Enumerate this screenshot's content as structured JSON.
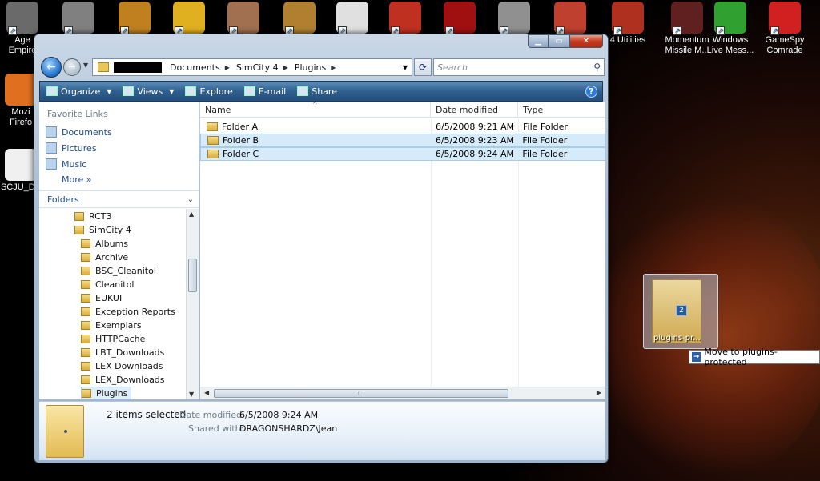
{
  "desktop": {
    "icons_top": [
      {
        "name": "age-empires-icon",
        "label": "Age\nEmpire",
        "color": "#6a6a6a"
      },
      {
        "name": "pyramid-game-icon",
        "label": "",
        "color": "#808080"
      },
      {
        "name": "samurai-game-icon",
        "label": "",
        "color": "#c08020"
      },
      {
        "name": "ring-game-icon",
        "label": "",
        "color": "#e0b020"
      },
      {
        "name": "castle-game-icon",
        "label": "",
        "color": "#a07050"
      },
      {
        "name": "civ-game-icon",
        "label": "",
        "color": "#b08030"
      },
      {
        "name": "panda-game-icon",
        "label": "",
        "color": "#e0e0e0"
      },
      {
        "name": "red-emblem-icon",
        "label": "",
        "color": "#c03020"
      },
      {
        "name": "red-dragon-icon",
        "label": "",
        "color": "#a01010"
      },
      {
        "name": "robot-game-icon",
        "label": "",
        "color": "#909090"
      },
      {
        "name": "simcity-4-icon",
        "label": "",
        "color": "#c04030"
      },
      {
        "name": "simcity-utilities-icon",
        "label": "4 Utilities",
        "color": "#b03020"
      },
      {
        "name": "momentum-missile-icon",
        "label": "Momentum\nMissile M...",
        "color": "#602020"
      },
      {
        "name": "windows-live-messenger-icon",
        "label": "Windows\nLive Mess...",
        "color": "#30a030"
      },
      {
        "name": "gamespy-comrade-icon",
        "label": "GameSpy\nComrade",
        "color": "#d02020"
      }
    ],
    "icons_left": [
      {
        "name": "firefox-icon",
        "label": "Mozi\nFirefo",
        "color": "#e07020"
      },
      {
        "name": "scju-doc-icon",
        "label": "SCJU_DE",
        "color": "#f0f0f0"
      }
    ]
  },
  "window": {
    "address": {
      "crumbs": [
        "Documents",
        "SimCity 4",
        "Plugins"
      ]
    },
    "search": {
      "placeholder": "Search"
    },
    "toolbar": {
      "organize": "Organize",
      "views": "Views",
      "explore": "Explore",
      "email": "E-mail",
      "share": "Share",
      "help": "?"
    },
    "nav": {
      "favorites_header": "Favorite Links",
      "favorites": [
        "Documents",
        "Pictures",
        "Music"
      ],
      "more": "More",
      "folders_header": "Folders",
      "tree": [
        {
          "label": "RCT3",
          "level": 0
        },
        {
          "label": "SimCity 4",
          "level": 0
        },
        {
          "label": "Albums",
          "level": 1
        },
        {
          "label": "Archive",
          "level": 1
        },
        {
          "label": "BSC_Cleanitol",
          "level": 1
        },
        {
          "label": "Cleanitol",
          "level": 1
        },
        {
          "label": "EUKUI",
          "level": 1
        },
        {
          "label": "Exception Reports",
          "level": 1
        },
        {
          "label": "Exemplars",
          "level": 1
        },
        {
          "label": "HTTPCache",
          "level": 1
        },
        {
          "label": "LBT_Downloads",
          "level": 1
        },
        {
          "label": "LEX Downloads",
          "level": 1
        },
        {
          "label": "LEX_Downloads",
          "level": 1
        },
        {
          "label": "Plugins",
          "level": 1,
          "selected": true
        }
      ]
    },
    "columns": [
      "Name",
      "Date modified",
      "Type"
    ],
    "files": [
      {
        "name": "Folder A",
        "date": "6/5/2008 9:21 AM",
        "type": "File Folder",
        "selected": false
      },
      {
        "name": "Folder B",
        "date": "6/5/2008 9:23 AM",
        "type": "File Folder",
        "selected": true
      },
      {
        "name": "Folder C",
        "date": "6/5/2008 9:24 AM",
        "type": "File Folder",
        "selected": true
      }
    ],
    "details": {
      "selection": "2 items selected",
      "date_label": "Date modified:",
      "date_value": "6/5/2008 9:24 AM",
      "shared_label": "Shared with:",
      "shared_value": "DRAGONSHARDZ\\Jean"
    }
  },
  "drag": {
    "count": "2",
    "label": "plugins-pr...",
    "tooltip": "Move to plugins-protected"
  }
}
